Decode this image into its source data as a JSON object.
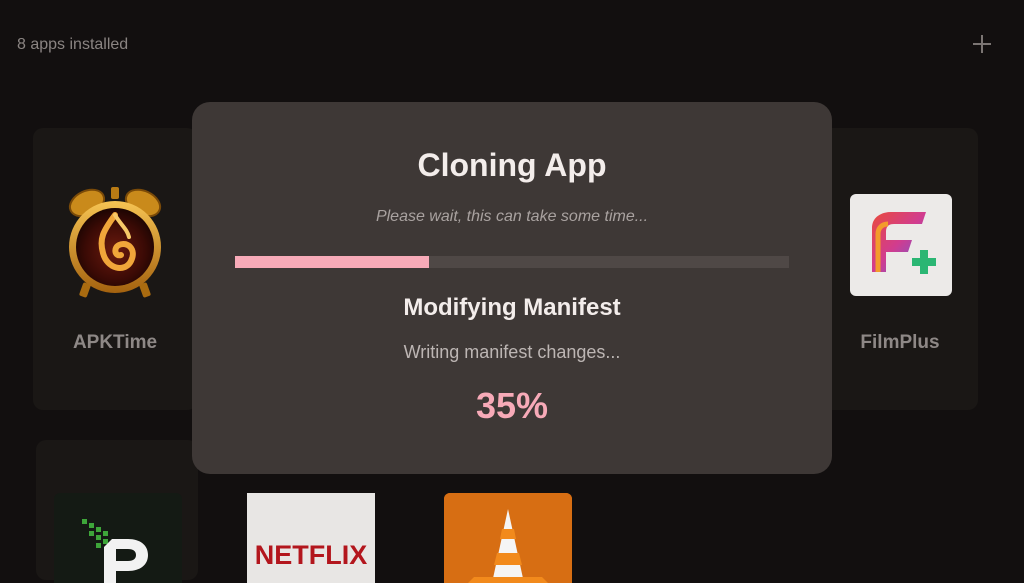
{
  "header": {
    "apps_count": "8 apps installed",
    "add_icon": "plus-icon"
  },
  "apps": [
    {
      "label": "APKTime",
      "icon": "apktime-alarm-clock-icon"
    },
    {
      "label": "FilmPlus",
      "icon": "filmplus-logo-icon"
    },
    {
      "label": "",
      "icon": "pixel-p-logo-icon"
    },
    {
      "label": "",
      "icon": "netflix-logo-icon",
      "logo_text": "NETFLIX"
    },
    {
      "label": "",
      "icon": "vlc-cone-icon"
    }
  ],
  "dialog": {
    "title": "Cloning App",
    "subtitle": "Please wait, this can take some time...",
    "step_title": "Modifying Manifest",
    "step_detail": "Writing manifest changes...",
    "percent_text": "35%",
    "progress": 0.35
  },
  "colors": {
    "background": "#120f0f",
    "dialog_bg": "#3e3836",
    "accent": "#f7aab8",
    "card_bg": "#1a1715"
  }
}
